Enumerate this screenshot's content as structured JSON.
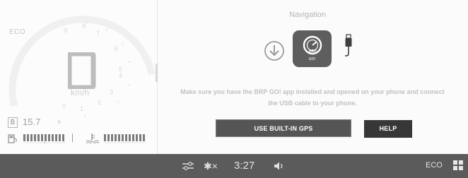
{
  "dashboard": {
    "mode": "ECO",
    "speed_unit": "km/h",
    "gear": "B",
    "range_value": "15.7",
    "range_unit": "h"
  },
  "navigation": {
    "title": "Navigation",
    "app_label": "GO!",
    "message": "Make sure you have the BRP GO! app installed and opened on your phone and connect the USB cable to your phone.",
    "use_builtin_gps_label": "USE BUILT-IN GPS",
    "help_label": "HELP"
  },
  "status_bar": {
    "bluetooth": "✱×",
    "time": "3:27",
    "mode": "ECO"
  },
  "icons": [
    "download-icon",
    "brp-go-app-icon",
    "usb-cable-icon",
    "settings-sliders-icon",
    "bluetooth-off-icon",
    "volume-icon",
    "grid-menu-icon",
    "fuel-icon",
    "coolant-temp-icon"
  ],
  "colors": {
    "status_bar": "#5b5b5b",
    "button_dark": "#373737",
    "button_gps": "#555555"
  }
}
